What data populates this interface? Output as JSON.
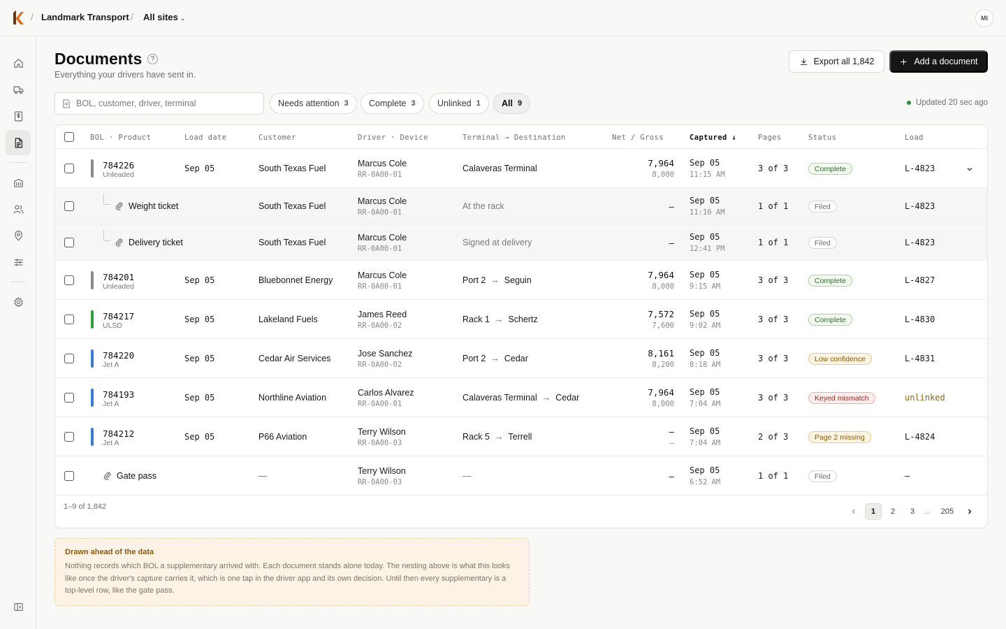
{
  "header": {
    "org": "Landmark Transport",
    "site": "All sites",
    "avatar": "MI"
  },
  "page": {
    "title": "Documents",
    "subtitle": "Everything your drivers have sent in.",
    "export_label": "Export all 1,842",
    "add_label": "Add a document",
    "updated": "Updated 20 sec ago"
  },
  "search": {
    "placeholder": "BOL, customer, driver, terminal"
  },
  "filters": [
    {
      "label": "Needs attention",
      "count": "3"
    },
    {
      "label": "Complete",
      "count": "3"
    },
    {
      "label": "Unlinked",
      "count": "1"
    },
    {
      "label": "All",
      "count": "9"
    }
  ],
  "columns": {
    "bol": "BOL · Product",
    "load_date": "Load date",
    "customer": "Customer",
    "driver": "Driver · Device",
    "route": "Terminal → Destination",
    "net": "Net / Gross",
    "captured": "Captured ↓",
    "pages": "Pages",
    "status": "Status",
    "load": "Load"
  },
  "rows": [
    {
      "bol": "784226",
      "product": "Unleaded",
      "bar": "#8a8a86",
      "date": "Sep 05",
      "customer": "South Texas Fuel",
      "driver": "Marcus Cole",
      "device": "RR-0A00-01",
      "from": "Calaveras Terminal",
      "to": "",
      "net": "7,964",
      "gross": "8,000",
      "cap_date": "Sep 05",
      "cap_time": "11:15 AM",
      "pages": "3 of 3",
      "status": "Complete",
      "load": "L-4823"
    },
    {
      "attachment": "Weight ticket",
      "customer": "South Texas Fuel",
      "driver": "Marcus Cole",
      "device": "RR-0A00-01",
      "note": "At the rack",
      "net": "—",
      "cap_date": "Sep 05",
      "cap_time": "11:16 AM",
      "pages": "1 of 1",
      "status": "Filed",
      "load": "L-4823"
    },
    {
      "attachment": "Delivery ticket",
      "customer": "South Texas Fuel",
      "driver": "Marcus Cole",
      "device": "RR-0A00-01",
      "note": "Signed at delivery",
      "net": "—",
      "cap_date": "Sep 05",
      "cap_time": "12:41 PM",
      "pages": "1 of 1",
      "status": "Filed",
      "load": "L-4823"
    },
    {
      "bol": "784201",
      "product": "Unleaded",
      "date": "Sep 05",
      "customer": "Bluebonnet Energy",
      "driver": "Marcus Cole",
      "device": "RR-0A00-01",
      "from": "Port 2",
      "to": "Seguin",
      "net": "7,964",
      "gross": "8,000",
      "cap_date": "Sep 05",
      "cap_time": "9:15 AM",
      "pages": "3 of 3",
      "status": "Complete",
      "load": "L-4827"
    },
    {
      "bol": "784217",
      "product": "ULSD",
      "date": "Sep 05",
      "customer": "Lakeland Fuels",
      "driver": "James Reed",
      "device": "RR-0A00-02",
      "from": "Rack 1",
      "to": "Schertz",
      "net": "7,572",
      "gross": "7,600",
      "cap_date": "Sep 05",
      "cap_time": "9:02 AM",
      "pages": "3 of 3",
      "status": "Complete",
      "load": "L-4830"
    },
    {
      "bol": "784220",
      "product": "Jet A",
      "date": "Sep 05",
      "customer": "Cedar Air Services",
      "driver": "Jose Sanchez",
      "device": "RR-0A00-02",
      "from": "Port 2",
      "to": "Cedar",
      "net": "8,161",
      "gross": "8,200",
      "cap_date": "Sep 05",
      "cap_time": "8:18 AM",
      "pages": "3 of 3",
      "status": "Low confidence",
      "load": "L-4831"
    },
    {
      "bol": "784193",
      "product": "Jet A",
      "date": "Sep 05",
      "customer": "Northline Aviation",
      "driver": "Carlos Alvarez",
      "device": "RR-0A00-01",
      "from": "Calaveras Terminal",
      "to": "Cedar",
      "net": "7,964",
      "gross": "8,000",
      "cap_date": "Sep 05",
      "cap_time": "7:04 AM",
      "pages": "3 of 3",
      "status": "Keyed mismatch",
      "load": "unlinked"
    },
    {
      "bol": "784212",
      "product": "Jet A",
      "date": "Sep 05",
      "customer": "P66 Aviation",
      "driver": "Terry Wilson",
      "device": "RR-0A00-03",
      "from": "Rack 5",
      "to": "Terrell",
      "net": "—",
      "gross": "—",
      "cap_date": "Sep 05",
      "cap_time": "7:04 AM",
      "pages": "2 of 3",
      "status": "Page 2 missing",
      "load": "L-4824"
    },
    {
      "attachment": "Gate pass",
      "customer": "—",
      "driver": "Terry Wilson",
      "device": "RR-0A00-03",
      "note": "—",
      "net": "—",
      "cap_date": "Sep 05",
      "cap_time": "6:52 AM",
      "pages": "1 of 1",
      "status": "Filed",
      "load": "–"
    }
  ],
  "footer": {
    "range": "1–9 of 1,842",
    "pages": [
      "1",
      "2",
      "3",
      "...",
      "205"
    ]
  },
  "note": {
    "title": "Drawn ahead of the data",
    "body": "Nothing records which BOL a supplementary arrived with. Each document stands alone today. The nesting above is what this looks like once the driver's capture carries it, which is one tap in the driver app and its own decision. Until then every supplementary is a top-level row, like the gate pass."
  },
  "colors": {
    "jet_a_bar": "#3b7bd0",
    "ulsd_bar": "#2e9e3e",
    "unleaded_bar": "#8a8a86",
    "primary_button": "#161616"
  }
}
